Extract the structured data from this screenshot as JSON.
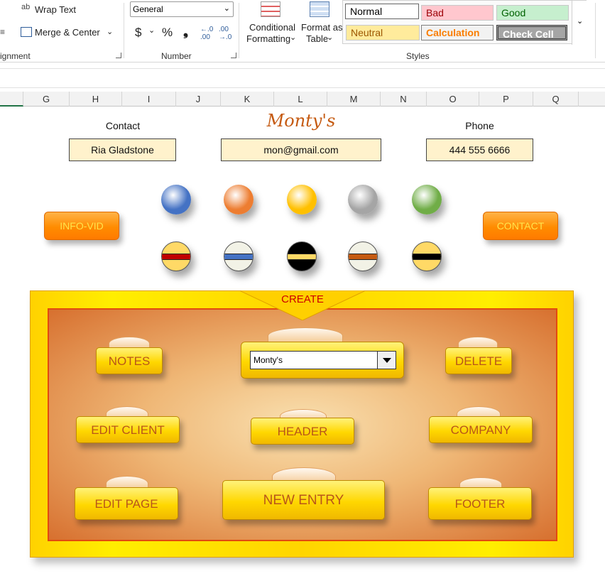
{
  "ribbon": {
    "alignment": {
      "wrap_text": "Wrap Text",
      "merge_center": "Merge & Center",
      "group_label": "ignment"
    },
    "number": {
      "format_value": "General",
      "currency": "$",
      "percent": "%",
      "comma": "❟",
      "group_label": "Number"
    },
    "styles": {
      "conditional_formatting": [
        "Conditional",
        "Formatting"
      ],
      "format_as_table": [
        "Format as",
        "Table"
      ],
      "group_label": "Styles",
      "cells": [
        {
          "label": "Normal",
          "bg": "#ffffff",
          "fg": "#000000"
        },
        {
          "label": "Bad",
          "bg": "#ffc7ce",
          "fg": "#9c0006"
        },
        {
          "label": "Good",
          "bg": "#c6efce",
          "fg": "#006100"
        },
        {
          "label": "Neutral",
          "bg": "#ffeb9c",
          "fg": "#9c5700"
        },
        {
          "label": "Calculation",
          "bg": "#f2f2f2",
          "fg": "#fa7d00"
        },
        {
          "label": "Check Cell",
          "bg": "#a5a5a5",
          "fg": "#ffffff"
        }
      ]
    }
  },
  "columns": [
    "G",
    "H",
    "I",
    "J",
    "K",
    "L",
    "M",
    "N",
    "O",
    "P",
    "Q"
  ],
  "sheet": {
    "contact_label": "Contact",
    "contact_value": "Ria Gladstone",
    "title": "Monty's",
    "email_value": "mon@gmail.com",
    "phone_label": "Phone",
    "phone_value": "444 555 6666",
    "info_vid_button": "INFO-VID",
    "contact_button": "CONTACT",
    "top_balls": [
      "#4472c4",
      "#ed7d31",
      "#ffc000",
      "#a5a5a5",
      "#70ad47"
    ],
    "stripe_balls": [
      {
        "body": "#ffd966",
        "stripe": "#c00000"
      },
      {
        "body": "#f2f2e6",
        "stripe": "#4472c4"
      },
      {
        "body": "#000000",
        "stripe": "#ffd966"
      },
      {
        "body": "#f2f2e6",
        "stripe": "#c55a11"
      },
      {
        "body": "#ffd966",
        "stripe": "#000000"
      }
    ]
  },
  "panel": {
    "create_label": "CREATE",
    "combo_value": "Monty's",
    "buttons": {
      "notes": "NOTES",
      "delete": "DELETE",
      "edit_client": "EDIT CLIENT",
      "header": "HEADER",
      "company": "COMPANY",
      "edit_page": "EDIT PAGE",
      "new_entry": "NEW ENTRY",
      "footer": "FOOTER"
    }
  }
}
